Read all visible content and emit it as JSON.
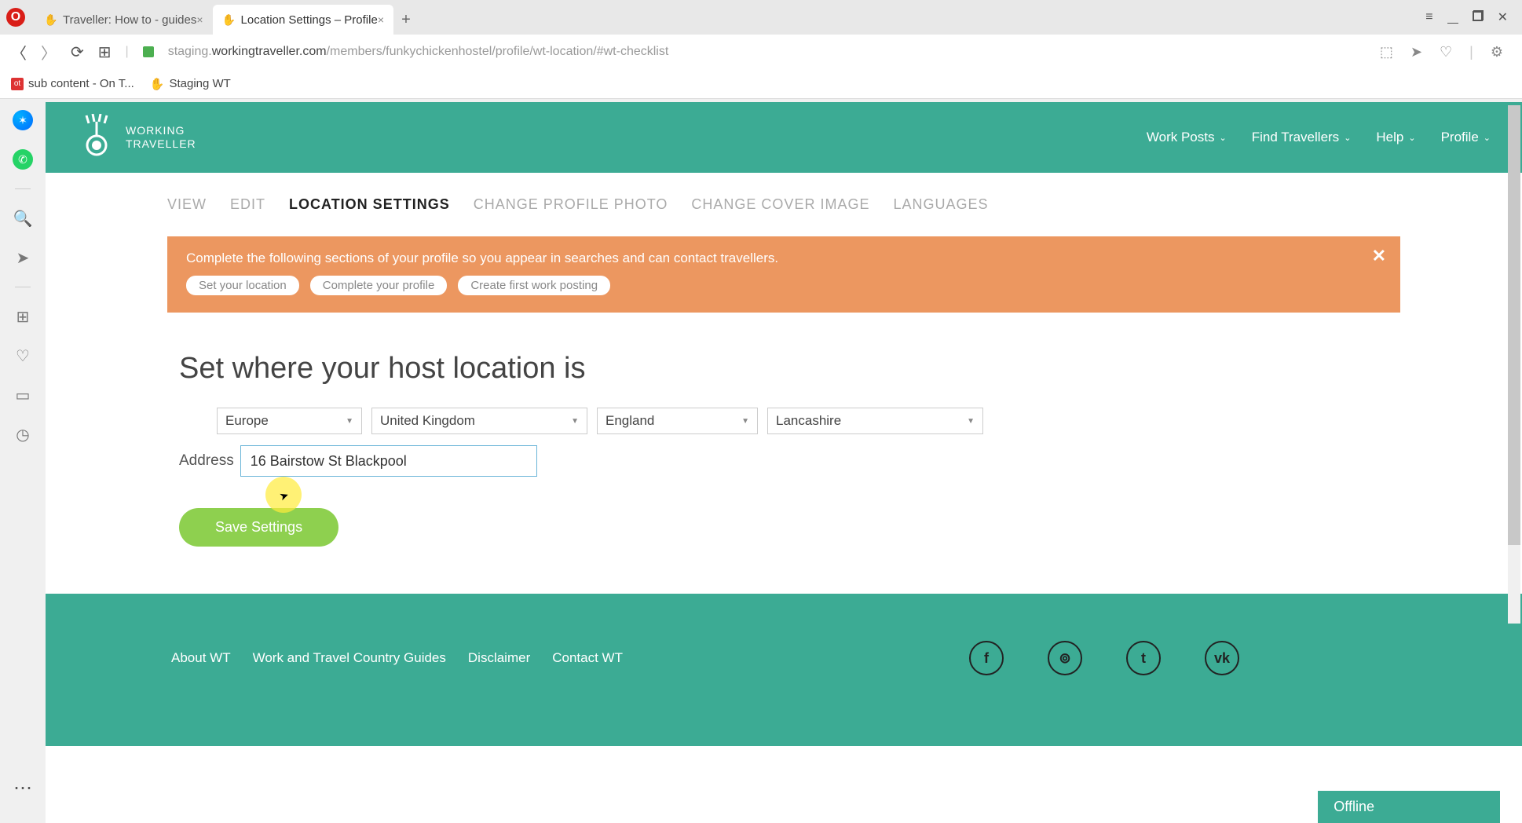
{
  "browser": {
    "tabs": [
      {
        "title": "Traveller: How to - guides",
        "active": false
      },
      {
        "title": "Location Settings – Profile",
        "active": true
      }
    ],
    "url_prefix": "staging.",
    "url_domain": "workingtraveller.com",
    "url_path": "/members/funkychickenhostel/profile/wt-location/#wt-checklist",
    "bookmarks": [
      {
        "label": "sub content - On T..."
      },
      {
        "label": "Staging WT"
      }
    ]
  },
  "header": {
    "logo_line1": "WORKING",
    "logo_line2": "TRAVELLER",
    "nav": [
      {
        "label": "Work Posts"
      },
      {
        "label": "Find Travellers"
      },
      {
        "label": "Help"
      },
      {
        "label": "Profile"
      }
    ]
  },
  "profile_tabs": [
    {
      "label": "VIEW",
      "active": false
    },
    {
      "label": "EDIT",
      "active": false
    },
    {
      "label": "LOCATION SETTINGS",
      "active": true
    },
    {
      "label": "CHANGE PROFILE PHOTO",
      "active": false
    },
    {
      "label": "CHANGE COVER IMAGE",
      "active": false
    },
    {
      "label": "LANGUAGES",
      "active": false
    }
  ],
  "notice": {
    "text": "Complete the following sections of your profile so you appear in searches and can contact travellers.",
    "pills": [
      "Set your location",
      "Complete your profile",
      "Create first work posting"
    ]
  },
  "form": {
    "title": "Set where your host location is",
    "continent": "Europe",
    "country": "United Kingdom",
    "region": "England",
    "subregion": "Lancashire",
    "address_label": "Address",
    "address_value": "16 Bairstow St Blackpool",
    "save_label": "Save Settings"
  },
  "footer": {
    "links": [
      "About WT",
      "Work and Travel Country Guides",
      "Disclaimer",
      "Contact WT"
    ],
    "social": [
      "f",
      "⊚",
      "t",
      "vk"
    ]
  },
  "status": {
    "offline": "Offline"
  }
}
